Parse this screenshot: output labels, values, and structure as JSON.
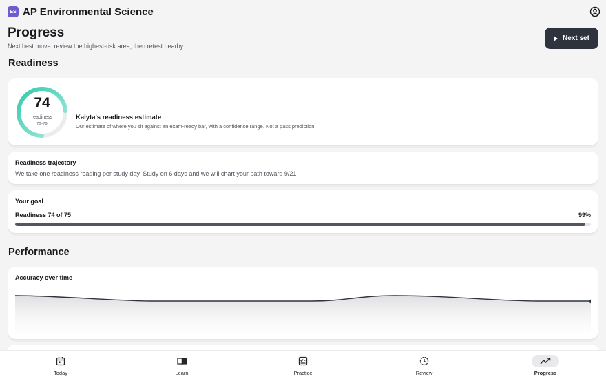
{
  "app": {
    "badge": "ES",
    "title": "AP Environmental Science"
  },
  "header": {
    "title": "Progress",
    "subtitle": "Next best move: review the highest-risk area, then retest nearby.",
    "next_button": "Next set"
  },
  "readiness": {
    "heading": "Readiness",
    "score": "74",
    "score_label": "readiness",
    "range": "70–79",
    "score_fraction": 0.74,
    "estimate_title": "Kalyta's readiness estimate",
    "estimate_text": "Our estimate of where you sit against an exam-ready bar, with a confidence range. Not a pass prediction."
  },
  "trajectory": {
    "title": "Readiness trajectory",
    "text": "We take one readiness reading per study day. Study on 6 days and we will chart your path toward 9/21."
  },
  "goal": {
    "title": "Your goal",
    "label": "Readiness 74 of 75",
    "percent": "99%",
    "fraction": 0.99
  },
  "performance": {
    "heading": "Performance",
    "accuracy_title": "Accuracy over time"
  },
  "colors": {
    "ring_start": "#35c9ae",
    "ring_end": "#a8ecdf",
    "bar": "#52565e",
    "button": "#2e333d"
  },
  "nav": {
    "items": [
      {
        "label": "Today",
        "icon": "calendar-icon"
      },
      {
        "label": "Learn",
        "icon": "book-icon"
      },
      {
        "label": "Practice",
        "icon": "practice-icon"
      },
      {
        "label": "Review",
        "icon": "history-icon"
      },
      {
        "label": "Progress",
        "icon": "trend-icon",
        "active": true
      }
    ]
  }
}
